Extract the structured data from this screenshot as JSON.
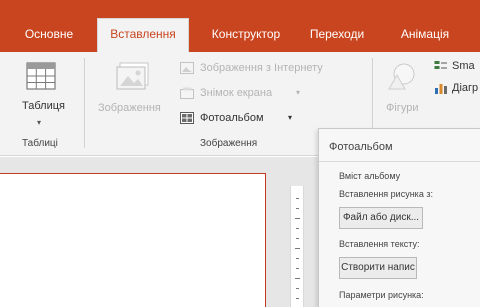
{
  "colors": {
    "accent": "#c9451f",
    "ribbon": "#f3f3f3"
  },
  "tabs": [
    {
      "label": "Основне",
      "active": false
    },
    {
      "label": "Вставлення",
      "active": true
    },
    {
      "label": "Конструктор",
      "active": false
    },
    {
      "label": "Переходи",
      "active": false
    },
    {
      "label": "Анімація",
      "active": false
    }
  ],
  "ribbon": {
    "tables_group": {
      "button_label": "Таблиця",
      "group_label": "Таблиці"
    },
    "images_group": {
      "pictures_label": "Зображення",
      "online_pictures_label": "Зображення з Інтернету",
      "screenshot_label": "Знімок екрана",
      "photo_album_label": "Фотоальбом",
      "group_label": "Зображення"
    },
    "illustrations_group": {
      "shapes_label": "Фігури",
      "smartart_label": "Sma",
      "chart_label": "Діагр"
    }
  },
  "pane": {
    "title": "Фотоальбом",
    "album_content_label": "Вміст альбому",
    "insert_picture_from_label": "Вставлення рисунка з:",
    "file_button_label": "Файл або диск...",
    "insert_text_label": "Вставлення тексту:",
    "new_caption_button_label": "Створити напис",
    "picture_options_label": "Параметри рисунка:"
  }
}
